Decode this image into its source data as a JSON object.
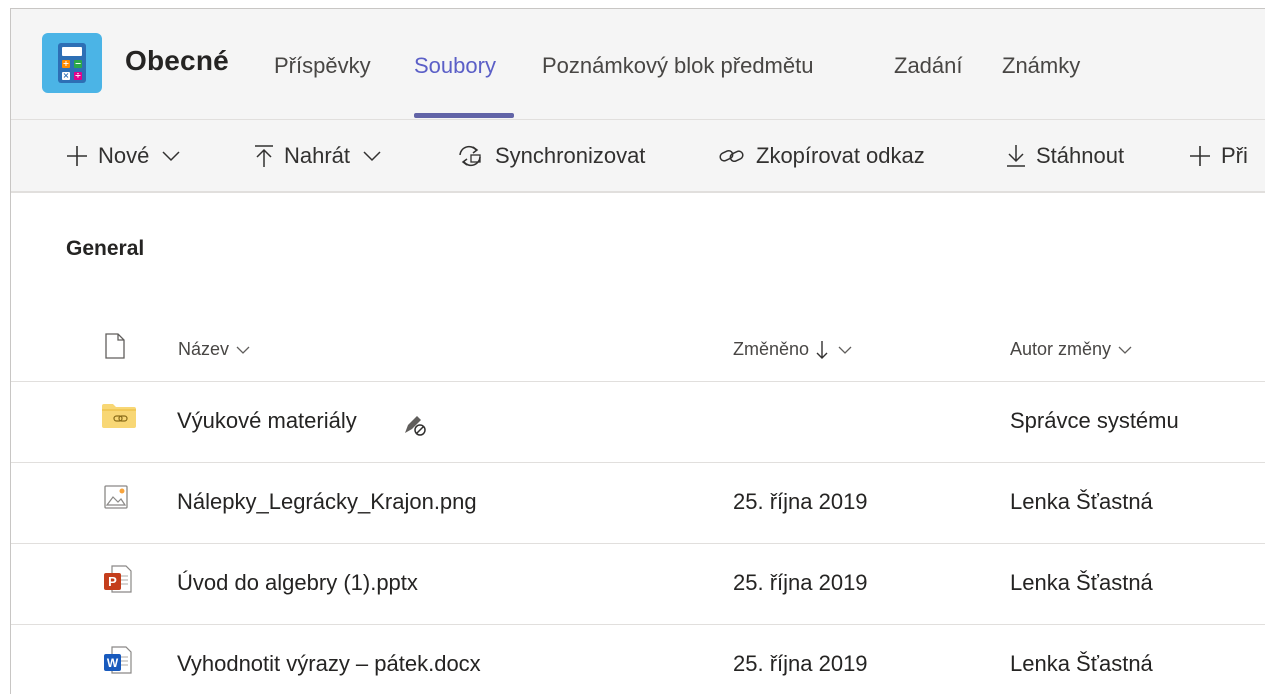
{
  "header": {
    "team_title": "Obecné",
    "tabs": [
      {
        "label": "Příspěvky",
        "active": false
      },
      {
        "label": "Soubory",
        "active": true
      },
      {
        "label": "Poznámkový blok předmětu",
        "active": false
      },
      {
        "label": "Zadání",
        "active": false
      },
      {
        "label": "Známky",
        "active": false
      }
    ]
  },
  "toolbar": {
    "new_label": "Nové",
    "upload_label": "Nahrát",
    "sync_label": "Synchronizovat",
    "copy_link_label": "Zkopírovat odkaz",
    "download_label": "Stáhnout",
    "add_label": "Při"
  },
  "section": {
    "title": "General"
  },
  "columns": {
    "name": "Název",
    "modified": "Změněno",
    "modified_by": "Autor změny"
  },
  "files": [
    {
      "icon": "folder-link-icon",
      "name": "Výukové materiály",
      "modified": "",
      "modified_by": "Správce systému"
    },
    {
      "icon": "image-file-icon",
      "name": "Nálepky_Legrácky_Krajon.png",
      "modified": "25. října 2019",
      "modified_by": "Lenka Šťastná"
    },
    {
      "icon": "powerpoint-file-icon",
      "name": "Úvod do algebry (1).pptx",
      "modified": "25. října 2019",
      "modified_by": "Lenka Šťastná"
    },
    {
      "icon": "word-file-icon",
      "name": "Vyhodnotit výrazy – pátek.docx",
      "modified": "25. října 2019",
      "modified_by": "Lenka Šťastná"
    }
  ],
  "colors": {
    "accent": "#6264a7",
    "active_tab": "#5b5fc7",
    "folder": "#f8d775",
    "powerpoint": "#c43e1c",
    "word": "#185abd"
  }
}
